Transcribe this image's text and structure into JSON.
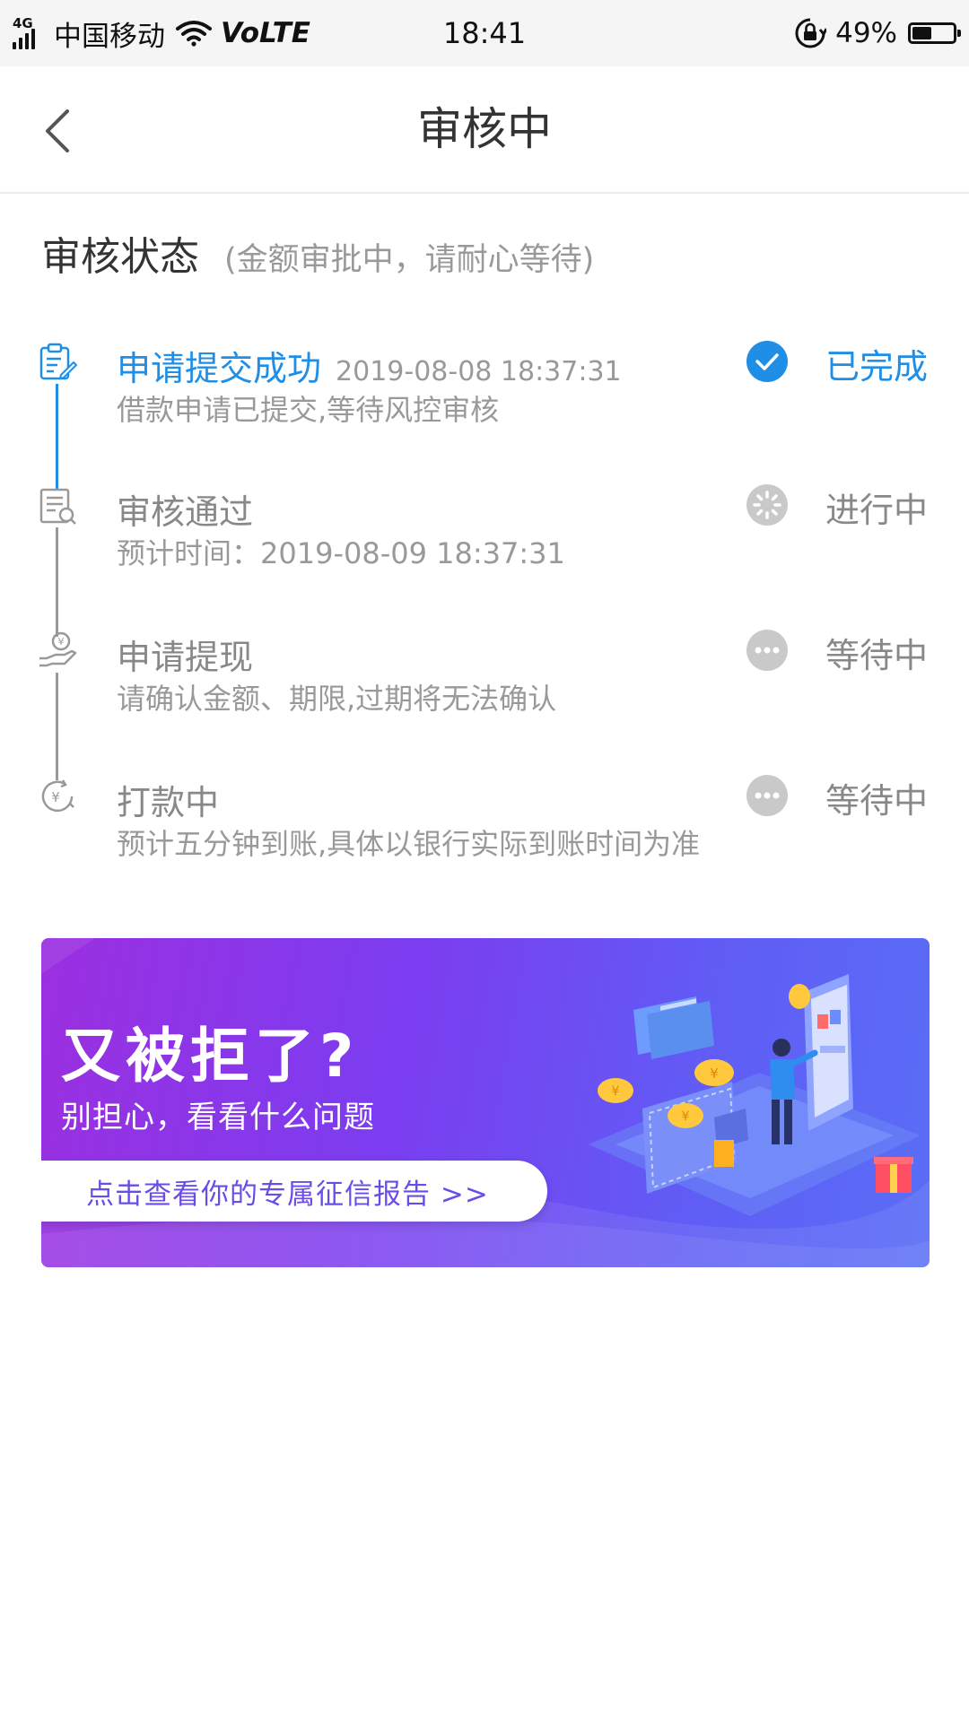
{
  "status_bar": {
    "network": "4G",
    "carrier": "中国移动",
    "volte": "VoLTE",
    "time": "18:41",
    "battery_percent": "49%",
    "battery_level": 0.49
  },
  "nav": {
    "title": "审核中"
  },
  "section": {
    "title": "审核状态",
    "subtitle": "(金额审批中，请耐心等待)"
  },
  "steps": [
    {
      "title": "申请提交成功",
      "time": "2019-08-08 18:37:31",
      "desc": "借款申请已提交,等待风控审核",
      "status": "已完成",
      "state": "done",
      "icon": "clipboard-icon"
    },
    {
      "title": "审核通过",
      "time": "",
      "desc": "预计时间：2019-08-09 18:37:31",
      "status": "进行中",
      "state": "in-progress",
      "icon": "document-search-icon"
    },
    {
      "title": "申请提现",
      "time": "",
      "desc": "请确认金额、期限,过期将无法确认",
      "status": "等待中",
      "state": "waiting",
      "icon": "hand-coin-icon"
    },
    {
      "title": "打款中",
      "time": "",
      "desc": "预计五分钟到账,具体以银行实际到账时间为准",
      "status": "等待中",
      "state": "waiting",
      "icon": "yuan-clock-icon"
    }
  ],
  "banner": {
    "title": "又被拒了?",
    "subtitle": "别担心，看看什么问题",
    "button_label": "点击查看你的专属征信报告 >>",
    "coin_symbol": "¥"
  },
  "colors": {
    "accent": "#1f8ee6",
    "muted": "#999999",
    "banner_start": "#9b2fe0",
    "banner_end": "#5a6ef6"
  }
}
